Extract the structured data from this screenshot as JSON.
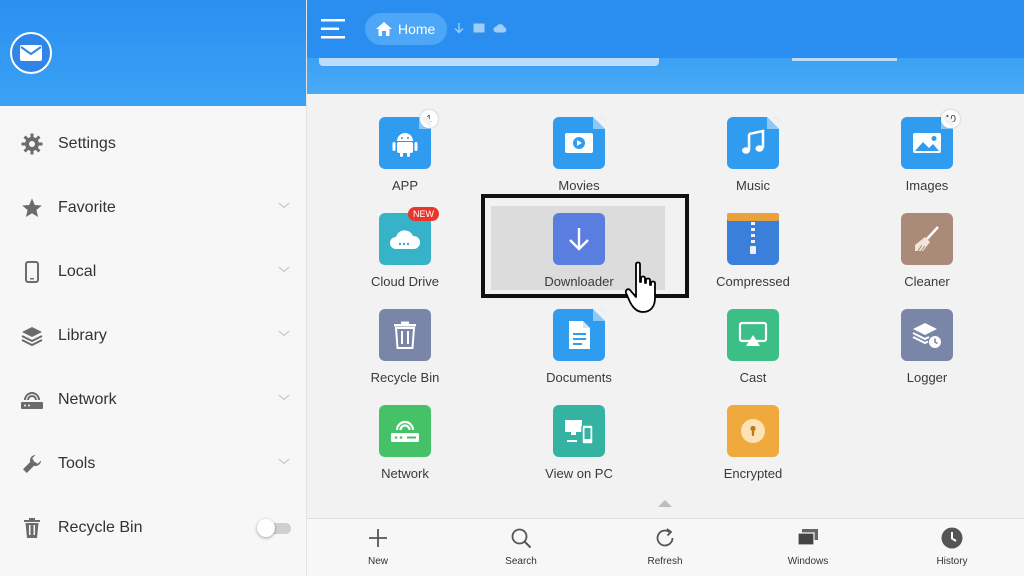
{
  "sidebar": {
    "items": [
      {
        "label": "Settings",
        "icon": "gear-icon"
      },
      {
        "label": "Favorite",
        "icon": "star-icon"
      },
      {
        "label": "Local",
        "icon": "phone-icon"
      },
      {
        "label": "Library",
        "icon": "layers-icon"
      },
      {
        "label": "Network",
        "icon": "router-icon"
      },
      {
        "label": "Tools",
        "icon": "wrench-icon"
      },
      {
        "label": "Recycle Bin",
        "icon": "trash-icon",
        "toggle_on": false
      }
    ]
  },
  "header": {
    "breadcrumb_home": "Home"
  },
  "categories": [
    {
      "label": "APP",
      "badge": "1",
      "color": "#2f9cf0"
    },
    {
      "label": "Movies",
      "color": "#2f9cf0"
    },
    {
      "label": "Music",
      "color": "#2f9cf0"
    },
    {
      "label": "Images",
      "badge": "10",
      "color": "#2f9cf0"
    },
    {
      "label": "Cloud Drive",
      "badge": "NEW",
      "color": "#37b3c9"
    },
    {
      "label": "Downloader",
      "color": "#5a7de0"
    },
    {
      "label": "Compressed",
      "color": "#3a7fd9"
    },
    {
      "label": "Cleaner",
      "color": "#a98b78"
    },
    {
      "label": "Recycle Bin",
      "color": "#7a86a8"
    },
    {
      "label": "Documents",
      "color": "#2f9cf0"
    },
    {
      "label": "Cast",
      "color": "#3cbf86"
    },
    {
      "label": "Logger",
      "color": "#7a86a8"
    },
    {
      "label": "Network",
      "color": "#45c167"
    },
    {
      "label": "View on PC",
      "color": "#35b3a2"
    },
    {
      "label": "Encrypted",
      "color": "#f0a93c"
    }
  ],
  "bottom_bar": [
    {
      "label": "New",
      "icon": "plus-icon"
    },
    {
      "label": "Search",
      "icon": "search-icon"
    },
    {
      "label": "Refresh",
      "icon": "refresh-icon"
    },
    {
      "label": "Windows",
      "icon": "windows-icon"
    },
    {
      "label": "History",
      "icon": "clock-icon"
    }
  ],
  "colors": {
    "accent": "#2a8ef0",
    "highlight_border": "#111111"
  }
}
